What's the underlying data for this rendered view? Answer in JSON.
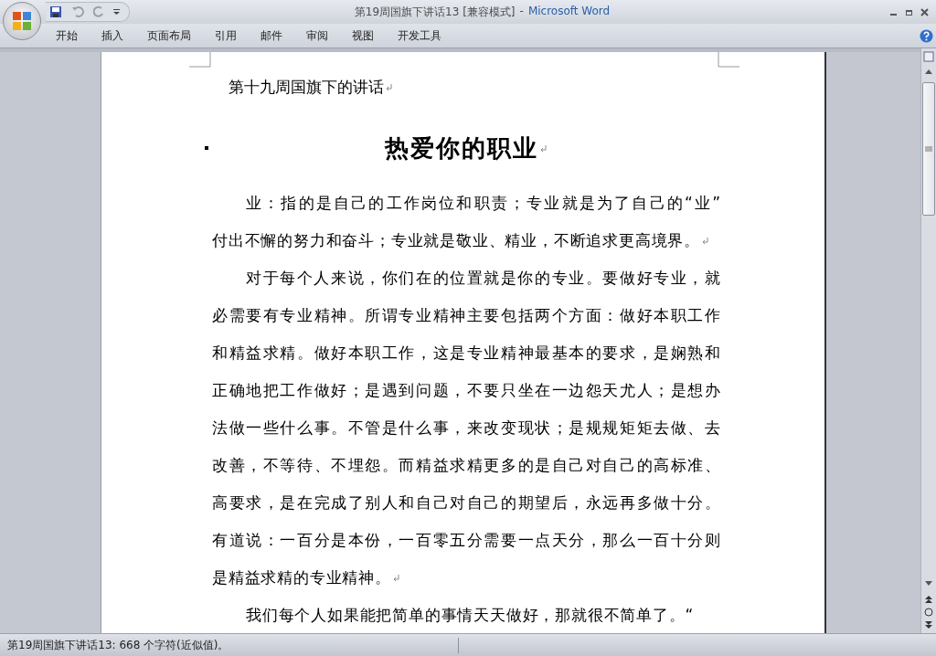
{
  "window": {
    "title_document": "第19周国旗下讲话13 [兼容模式]",
    "title_separator": "-",
    "title_app": "Microsoft Word"
  },
  "ribbon_tabs": [
    "开始",
    "插入",
    "页面布局",
    "引用",
    "邮件",
    "审阅",
    "视图",
    "开发工具"
  ],
  "document": {
    "header_line": "第十九周国旗下的讲话",
    "heading": "热爱你的职业",
    "paragraphs": [
      {
        "end_mark": true,
        "lines": [
          "业：指的是自己的工作岗位和职责；专业就是为了自己的“业”",
          "付出不懈的努力和奋斗；专业就是敬业、精业，不断追求更高境界。"
        ]
      },
      {
        "end_mark": true,
        "lines": [
          "对于每个人来说，你们在的位置就是你的专业。要做好专业，就",
          "必需要有专业精神。所谓专业精神主要包括两个方面：做好本职工作",
          "和精益求精。做好本职工作，这是专业精神最基本的要求，是娴熟和",
          "正确地把工作做好；是遇到问题，不要只坐在一边怨天尤人；是想办",
          "法做一些什么事。不管是什么事，来改变现状；是规规矩矩去做、去",
          "改善，不等待、不埋怨。而精益求精更多的是自己对自己的高标准、",
          "高要求，是在完成了别人和自己对自己的期望后，永远再多做十分。",
          "有道说：一百分是本份，一百零五分需要一点天分，那么一百十分则",
          "是精益求精的专业精神。"
        ]
      },
      {
        "end_mark": false,
        "lines": [
          "我们每个人如果能把简单的事情天天做好，那就很不简单了。“"
        ]
      }
    ]
  },
  "status_bar": {
    "text": "第19周国旗下讲话13: 668 个字符(近似值)。"
  }
}
